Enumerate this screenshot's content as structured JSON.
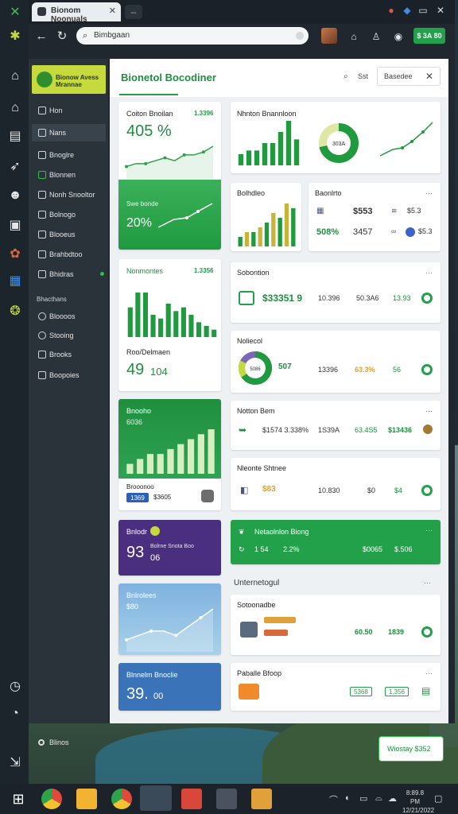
{
  "browser": {
    "tab_title": "Bionom Noonuals",
    "address": "Bimbgaan",
    "action_badge": "$ 3A 80"
  },
  "sidebar": {
    "brand": "Bionow Avess Mrannae",
    "items": [
      {
        "label": "Hon",
        "icon": "square-icon"
      },
      {
        "label": "Nans",
        "icon": "square-icon"
      },
      {
        "label": "Bnoglre",
        "icon": "square-icon"
      },
      {
        "label": "Blonnen",
        "icon": "square-icon"
      },
      {
        "label": "Nonh Snooltor",
        "icon": "square-icon"
      },
      {
        "label": "Bolnogo",
        "icon": "square-icon"
      },
      {
        "label": "Blooeus",
        "icon": "square-icon"
      },
      {
        "label": "Brahbdtoo",
        "icon": "square-icon"
      },
      {
        "label": "Bhidras",
        "icon": "square-icon"
      }
    ],
    "section_label": "Bhacthans",
    "section_items": [
      {
        "label": "Bloooos"
      },
      {
        "label": "Stooing"
      },
      {
        "label": "Brooks"
      },
      {
        "label": "Boopoies"
      }
    ],
    "bottom_item": "Blinos"
  },
  "header": {
    "title": "Bionetol Bocodiner",
    "search_short": "Sst",
    "search_value": "Basedee"
  },
  "cards": {
    "c1": {
      "title": "Coiton Bnoilan",
      "tag": "1.3396",
      "value": "405 %",
      "mid_label": "Swe bonde",
      "value2": "20%"
    },
    "c2": {
      "title": "Nhnton Bnannloon",
      "donut_label": "303A"
    },
    "c3": {
      "title": "Bolhdleo"
    },
    "c4": {
      "title": "Baonlrto",
      "v1": "$553",
      "v2": "$5.3",
      "v3": "508%",
      "v4": "3457"
    },
    "c5": {
      "title": "Nonmontes",
      "tag": "1.3356",
      "sub": "Roo/Delmaen",
      "value": "49",
      "value2": "104"
    },
    "c6": {
      "title": "Sobontion",
      "amount": "$33351 9",
      "a": "10.396",
      "b": "50.3A6",
      "c": "13.93"
    },
    "c7": {
      "title": "Noliecol",
      "center": "5086",
      "pct": "507",
      "a": "13396",
      "b": "63.3%",
      "c": "56"
    },
    "c8": {
      "title": "Bnooho",
      "value": "6036",
      "sub": "Brooonoo",
      "pill": "1369",
      "sub2": "$3605"
    },
    "c9": {
      "title": "Notton Bem",
      "a": "$1574 3.338%",
      "b": "1S39A",
      "c": "63.4S5",
      "d": "$13436"
    },
    "c10": {
      "title": "Nleonte Shtnee",
      "a": "$83",
      "b": "10.830",
      "c": "$0",
      "d": "$4"
    },
    "c11": {
      "title": "Bnlodr",
      "value": "93",
      "sub": "06",
      "line": "Bolrne Snota Boo"
    },
    "c12": {
      "title": "Netaolnlon Biong",
      "a": "1 54",
      "b": "2.2%",
      "c": "$0065",
      "d": "$.506"
    },
    "c13": {
      "title": "Bnlrolees",
      "value": "$80"
    },
    "c14_section": "Unternetogul",
    "c14": {
      "title": "Sotoonadbe",
      "a": "60.50",
      "b": "1839"
    },
    "c15": {
      "title": "Blnnelm Bnoclie",
      "value": "39.",
      "sub": "00"
    },
    "c16": {
      "title": "Paballe Bfoop",
      "a": "5368",
      "b": "1.356"
    }
  },
  "toast": "Wiostay $352",
  "clock": {
    "time": "8:89.8 PM",
    "date": "12/21/2022"
  },
  "chart_data": [
    {
      "type": "line",
      "title": "Coiton Bnoilan",
      "x": [
        1,
        2,
        3,
        4,
        5,
        6,
        7,
        8,
        9,
        10
      ],
      "y": [
        4,
        5,
        5,
        6,
        7,
        6,
        8,
        8,
        9,
        11
      ]
    },
    {
      "type": "bar",
      "title": "Nhnton Bnannloon",
      "categories": [
        "1",
        "2",
        "3",
        "4",
        "5",
        "6",
        "7",
        "8"
      ],
      "values": [
        3,
        4,
        4,
        6,
        6,
        9,
        12,
        7
      ]
    },
    {
      "type": "bar",
      "title": "Bolhdleo",
      "categories": [
        "1",
        "2",
        "3",
        "4",
        "5",
        "6",
        "7",
        "8",
        "9"
      ],
      "values": [
        2,
        3,
        3,
        4,
        5,
        7,
        6,
        9,
        8
      ]
    },
    {
      "type": "bar",
      "title": "Nonmontes",
      "categories": [
        "1",
        "2",
        "3",
        "4",
        "5",
        "6",
        "7",
        "8",
        "9",
        "10",
        "11",
        "12"
      ],
      "values": [
        8,
        12,
        12,
        6,
        5,
        9,
        7,
        8,
        6,
        4,
        3,
        2
      ]
    },
    {
      "type": "bar",
      "title": "Bnooho",
      "categories": [
        "1",
        "2",
        "3",
        "4",
        "5",
        "6",
        "7",
        "8",
        "9"
      ],
      "values": [
        2,
        3,
        4,
        4,
        5,
        6,
        7,
        8,
        9
      ]
    },
    {
      "type": "line",
      "title": "Bnlrolees",
      "x": [
        1,
        2,
        3,
        4,
        5,
        6,
        7,
        8
      ],
      "y": [
        2,
        3,
        4,
        4,
        3,
        5,
        7,
        9
      ]
    }
  ]
}
